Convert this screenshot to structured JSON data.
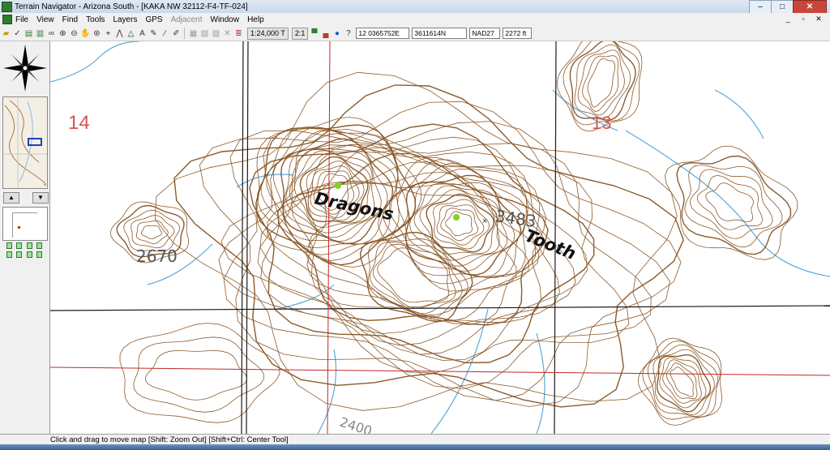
{
  "window": {
    "title": "Terrain Navigator - Arizona South - [KAKA NW 32112-F4-TF-024]"
  },
  "menu": [
    "File",
    "View",
    "Find",
    "Tools",
    "Layers",
    "GPS",
    "Adjacent",
    "Window",
    "Help"
  ],
  "menu_disabled": [
    "Adjacent"
  ],
  "toolbar": {
    "scale": "1:24,000 T",
    "zoom": "2:1",
    "easting": "12 0365752E",
    "northing": "3611614N",
    "datum": "NAD27",
    "elevation": "2272 ft"
  },
  "map": {
    "labels": {
      "name1": "Dragons",
      "name2": "Tooth",
      "elev1": "3483",
      "elev2": "2670",
      "elev3": "2400",
      "section1": "14",
      "section2": "13"
    }
  },
  "status": "Click and drag to move map [Shift: Zoom Out] [Shift+Ctrl: Center Tool]"
}
